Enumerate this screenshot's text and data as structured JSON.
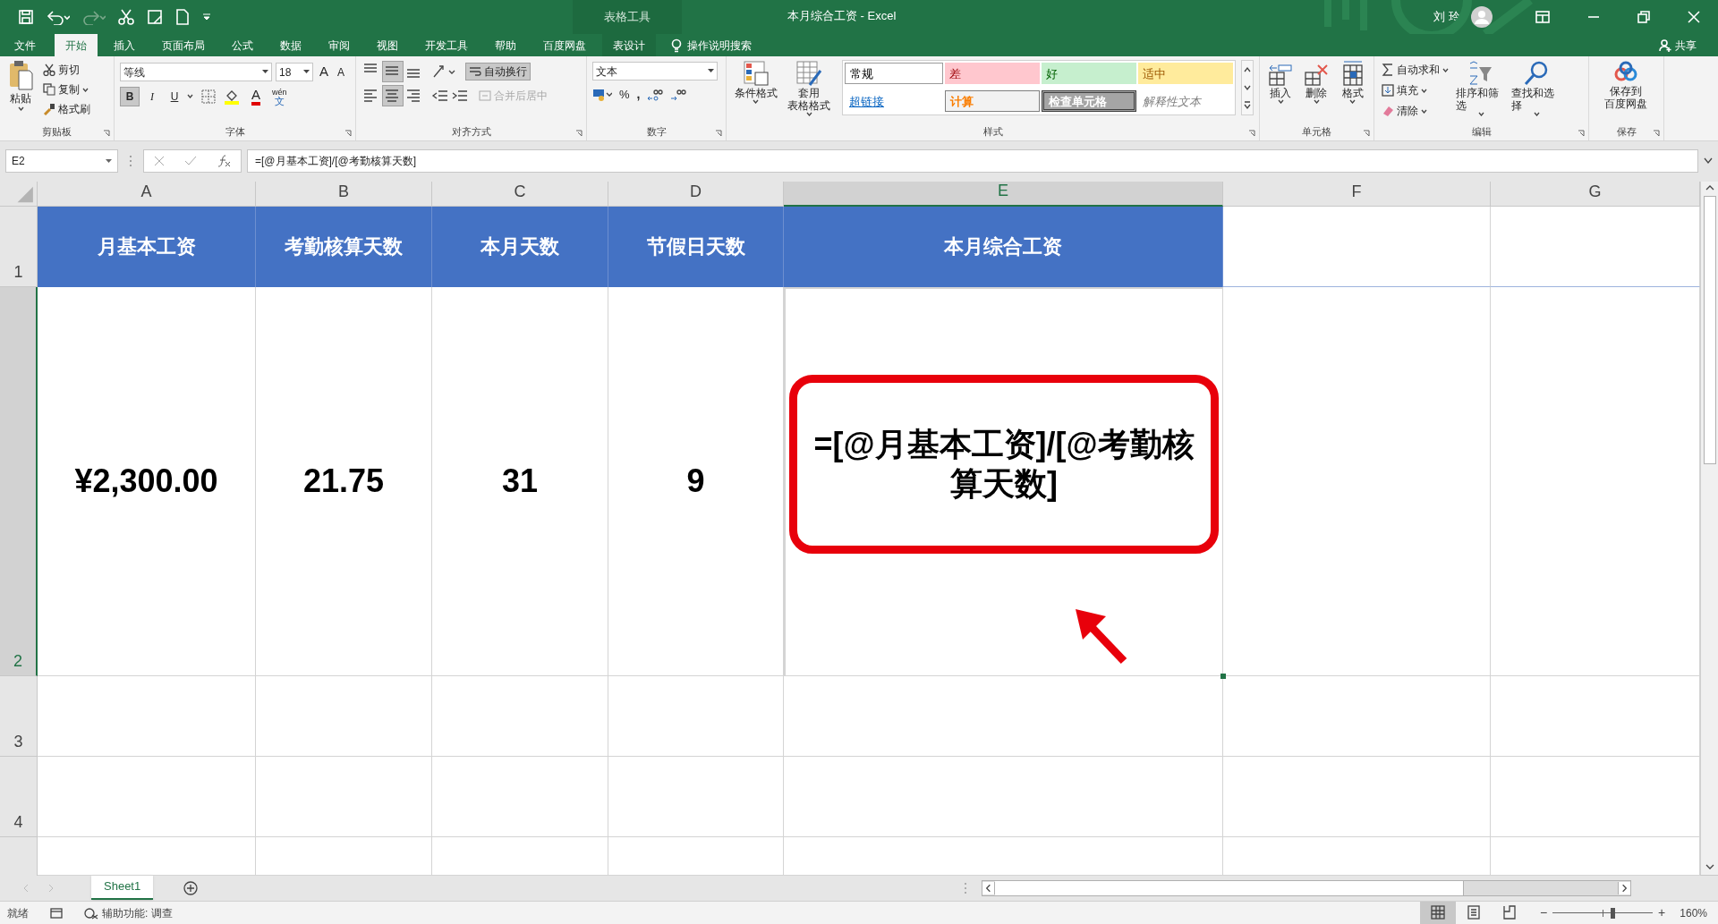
{
  "window": {
    "title": "本月综合工资  -  Excel",
    "context_label": "表格工具",
    "user": "刘 玲"
  },
  "tabs": [
    {
      "label": "文件",
      "selected": false
    },
    {
      "label": "开始",
      "selected": true
    },
    {
      "label": "插入",
      "selected": false
    },
    {
      "label": "页面布局",
      "selected": false
    },
    {
      "label": "公式",
      "selected": false
    },
    {
      "label": "数据",
      "selected": false
    },
    {
      "label": "审阅",
      "selected": false
    },
    {
      "label": "视图",
      "selected": false
    },
    {
      "label": "开发工具",
      "selected": false
    },
    {
      "label": "帮助",
      "selected": false
    },
    {
      "label": "百度网盘",
      "selected": false
    },
    {
      "label": "表设计",
      "selected": false,
      "kind": "context"
    }
  ],
  "tell_me": "操作说明搜索",
  "share": "共享",
  "ribbon": {
    "clipboard": {
      "paste": "粘贴",
      "cut": "剪切",
      "copy": "复制",
      "painter": "格式刷",
      "label": "剪贴板"
    },
    "font": {
      "name": "等线",
      "size": "18",
      "grow": "A",
      "shrink": "A",
      "styles": [
        {
          "label": "B",
          "selected": true
        },
        {
          "label": "I",
          "selected": false
        },
        {
          "label": "U",
          "selected": false
        }
      ],
      "color_letter": "A",
      "phonetic_top": "wén",
      "phonetic_bottom": "文",
      "label": "字体"
    },
    "alignment": {
      "buttons": [
        {
          "kind": "top",
          "selected": false
        },
        {
          "kind": "middle",
          "selected": true
        },
        {
          "kind": "bottom",
          "selected": false
        },
        {
          "kind": "left",
          "selected": false
        },
        {
          "kind": "center",
          "selected": true
        },
        {
          "kind": "right",
          "selected": false
        }
      ],
      "wrap": {
        "label": "自动换行",
        "selected": true
      },
      "merge": {
        "label": "合并后居中",
        "disabled": true
      },
      "label": "对齐方式"
    },
    "number": {
      "format": "文本",
      "percent": "%",
      "comma": ",",
      "label": "数字"
    },
    "styles": {
      "conditional": "条件格式",
      "table_top": "套用",
      "table_bottom": "表格格式",
      "gallery": [
        {
          "label": "常规",
          "kind": "normal"
        },
        {
          "label": "差",
          "kind": "bad"
        },
        {
          "label": "好",
          "kind": "good"
        },
        {
          "label": "适中",
          "kind": "neutral"
        },
        {
          "label": "超链接",
          "kind": "link"
        },
        {
          "label": "计算",
          "kind": "calc"
        },
        {
          "label": "检查单元格",
          "kind": "check"
        },
        {
          "label": "解释性文本",
          "kind": "note"
        }
      ],
      "label": "样式"
    },
    "cells": {
      "insert": "插入",
      "delete": "删除",
      "format": "格式",
      "label": "单元格"
    },
    "editing": {
      "autosum": "自动求和",
      "fill": "填充",
      "clear": "清除",
      "sort": "排序和筛选",
      "find": "查找和选择",
      "label": "编辑"
    },
    "save": {
      "top": "保存到",
      "bottom": "百度网盘",
      "label": "保存"
    }
  },
  "formula_bar": {
    "name_box": "E2",
    "formula": "=[@月基本工资]/[@考勤核算天数]"
  },
  "columns": [
    {
      "label": "A",
      "selected": false
    },
    {
      "label": "B",
      "selected": false
    },
    {
      "label": "C",
      "selected": false
    },
    {
      "label": "D",
      "selected": false
    },
    {
      "label": "E",
      "selected": true
    },
    {
      "label": "F",
      "selected": false
    },
    {
      "label": "G",
      "selected": false
    }
  ],
  "rows": [
    {
      "label": "1",
      "selected": false
    },
    {
      "label": "2",
      "selected": true
    },
    {
      "label": "3",
      "selected": false
    },
    {
      "label": "4",
      "selected": false
    }
  ],
  "table": {
    "headers": [
      "月基本工资",
      "考勤核算天数",
      "本月天数",
      "节假日天数",
      "本月综合工资"
    ],
    "row": [
      {
        "text": "¥2,300.00",
        "highlighted": false
      },
      {
        "text": "21.75",
        "highlighted": false
      },
      {
        "text": "31",
        "highlighted": false
      },
      {
        "text": "9",
        "highlighted": false
      },
      {
        "text": "=[@月基本工资]/[@考勤核算天数]",
        "highlighted": true
      }
    ]
  },
  "sheets": [
    {
      "label": "Sheet1",
      "selected": true
    }
  ],
  "status_bar": {
    "ready": "就绪",
    "accessibility": "辅助功能: 调查",
    "zoom_out": "−",
    "zoom_slider": {
      "level": 0.6
    },
    "zoom_in": "+",
    "zoom": "160%"
  }
}
